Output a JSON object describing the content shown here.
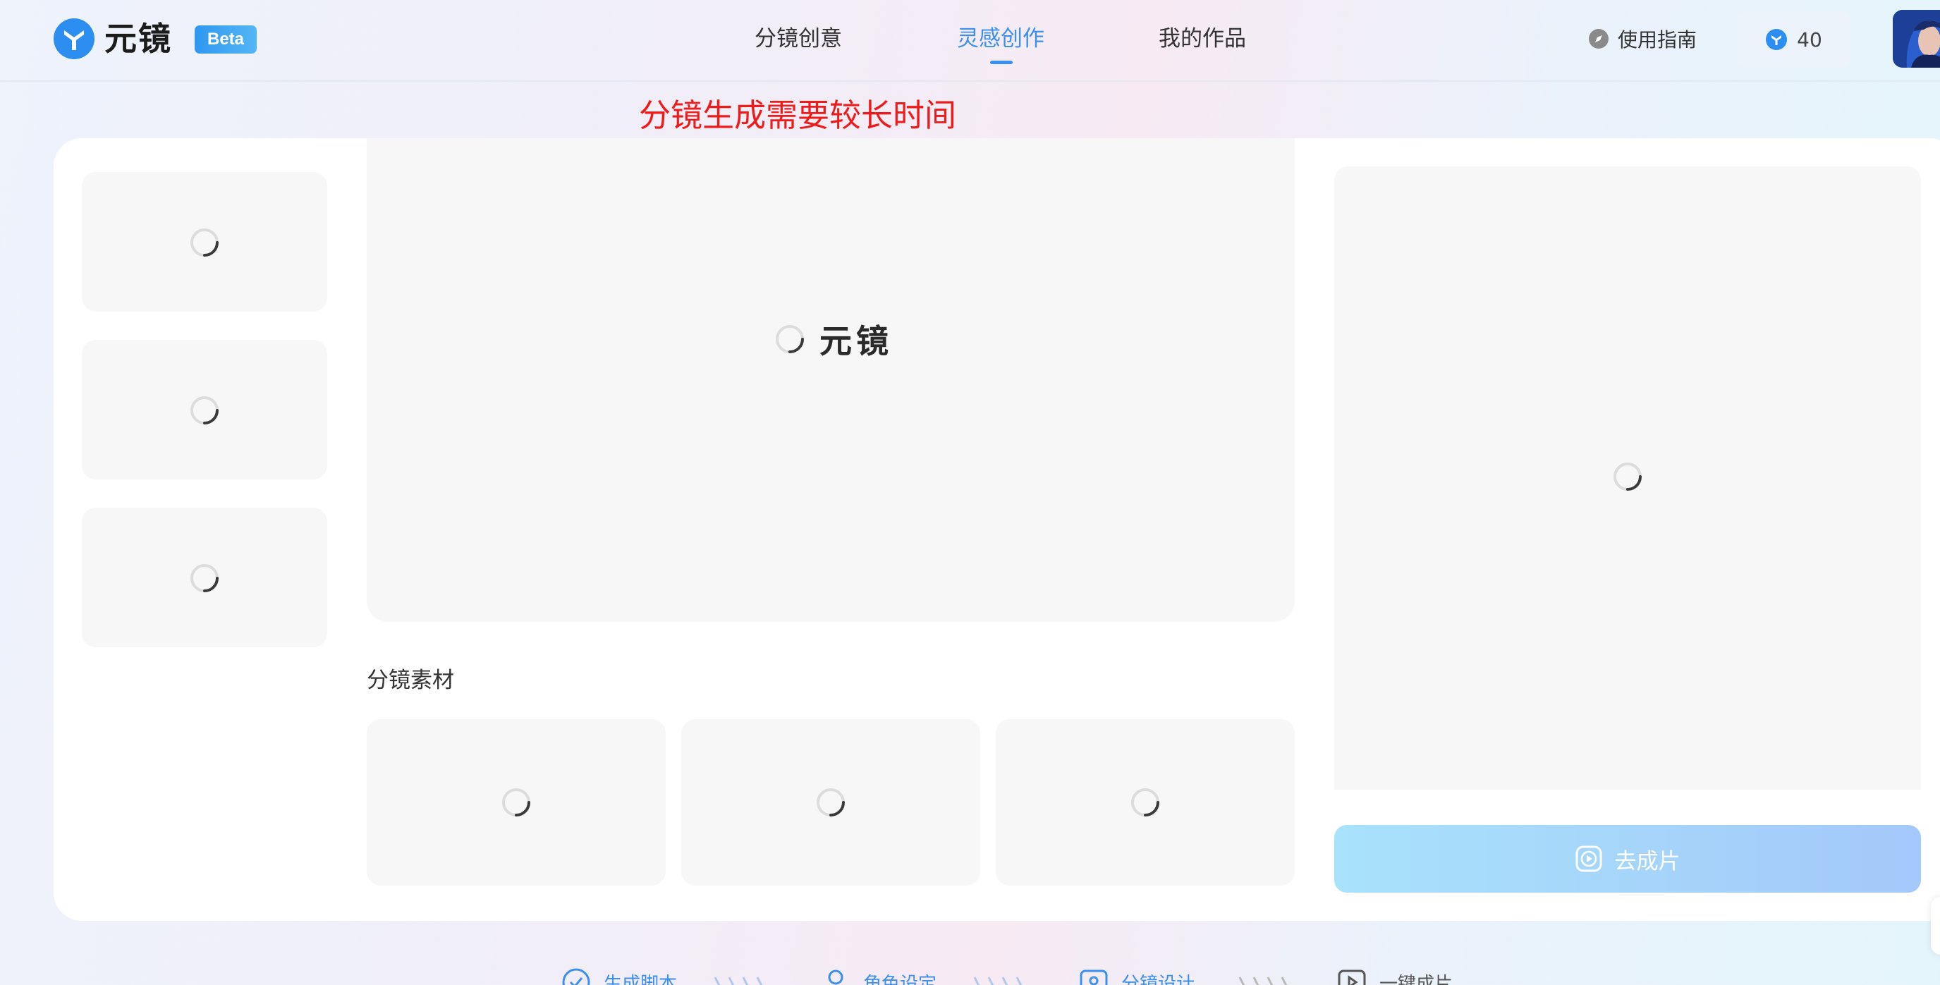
{
  "header": {
    "brand": "元镜",
    "beta": "Beta",
    "nav": [
      {
        "label": "分镜创意",
        "active": false
      },
      {
        "label": "灵感创作",
        "active": true
      },
      {
        "label": "我的作品",
        "active": false
      }
    ],
    "guide_label": "使用指南",
    "credits": "40",
    "accent_color": "#3b8ff0"
  },
  "notice": {
    "text": "分镜生成需要较长时间",
    "color": "#ee1b1b"
  },
  "preview": {
    "loading_brand": "元镜"
  },
  "materials": {
    "title": "分镜素材"
  },
  "actions": {
    "go_button_label": "去成片"
  },
  "steps": [
    {
      "label": "生成脚本",
      "icon": "check-circle-icon"
    },
    {
      "label": "角色设定",
      "icon": "person-icon"
    },
    {
      "label": "分镜设计",
      "icon": "image-frame-icon"
    },
    {
      "label": "一键成片",
      "icon": "play-frame-icon"
    }
  ]
}
